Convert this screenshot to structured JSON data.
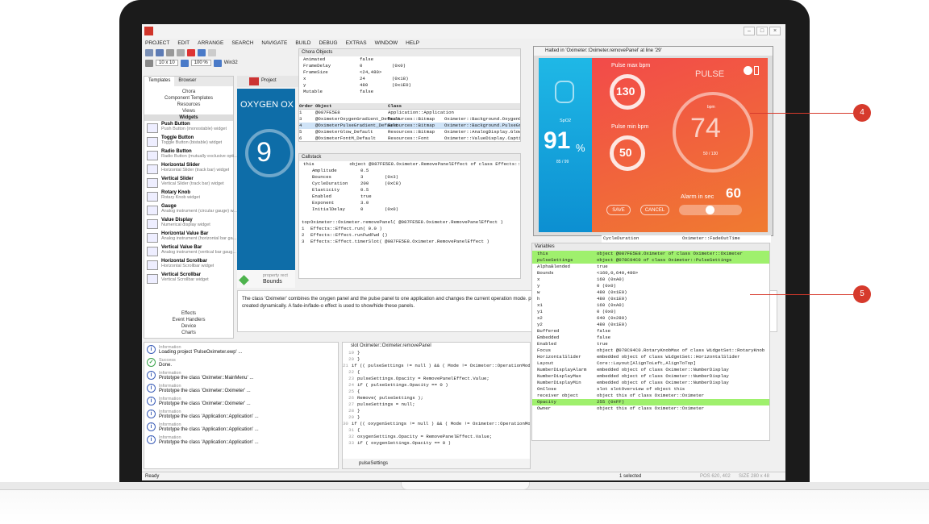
{
  "menu": [
    "PROJECT",
    "EDIT",
    "ARRANGE",
    "SEARCH",
    "NAVIGATE",
    "BUILD",
    "DEBUG",
    "EXTRAS",
    "WINDOW",
    "HELP"
  ],
  "toolbar": {
    "zoom1": "10 x 10",
    "zoom2": "100 %",
    "platform": "Win32"
  },
  "left": {
    "tabs": [
      "Templates",
      "Browser"
    ],
    "tree": [
      "Chora",
      "Component Templates",
      "Resources",
      "Views"
    ],
    "section": "Widgets",
    "widgets": [
      {
        "name": "Push Button",
        "desc": "Push Button (monostable) widget"
      },
      {
        "name": "Toggle Button",
        "desc": "Toggle Button (bistable) widget"
      },
      {
        "name": "Radio Button",
        "desc": "Radio Button (mutually exclusive opti..."
      },
      {
        "name": "Horizontal Slider",
        "desc": "Horizontal Slider (track bar) widget"
      },
      {
        "name": "Vertical Slider",
        "desc": "Vertical Slider (track bar) widget"
      },
      {
        "name": "Rotary Knob",
        "desc": "Rotary Knob widget"
      },
      {
        "name": "Gauge",
        "desc": "Analog instrument (circular gauge) w..."
      },
      {
        "name": "Value Display",
        "desc": "Numerical display widget"
      },
      {
        "name": "Horizontal Value Bar",
        "desc": "Analog instrument (horizontal bar ga..."
      },
      {
        "name": "Vertical Value Bar",
        "desc": "Analog instrument (vertical bar gaug..."
      },
      {
        "name": "Horizontal Scrollbar",
        "desc": "Horizontal Scrollbar widget"
      },
      {
        "name": "Vertical Scrollbar",
        "desc": "Vertical Scrollbar widget"
      }
    ],
    "bottom": [
      "Effects",
      "Event Handlers",
      "Device",
      "Charts"
    ]
  },
  "canvas": {
    "title": "OXYGEN OX",
    "project_tab": "Project",
    "prop_label": "property rect",
    "prop_name": "Bounds",
    "big": "9"
  },
  "description": "The class 'Oximeter' combines the oxygen panel and the pulse panel to one application and changes the current operation mode. pulse oximeter. All temporarily used panels, like the main menu, the graph panel or the settings panels are created dynamically. A fade-in/fade-o effect is used to show/hide these panels.",
  "chora": {
    "title": "Chora Objects",
    "props": [
      [
        "Animated",
        "false",
        ""
      ],
      [
        "FrameDelay",
        "0",
        "(0x0)"
      ],
      [
        "FrameSize",
        "<24,480>",
        ""
      ],
      [
        "x",
        "24",
        "(0x18)"
      ],
      [
        "y",
        "480",
        "(0x1E0)"
      ],
      [
        "Mutable",
        "false",
        ""
      ]
    ],
    "cols": [
      "Order",
      "Object",
      "Class"
    ],
    "rows": [
      [
        "1",
        "@087FE5E8",
        "Application::Application"
      ],
      [
        "3",
        "@OximeterOxygenGradient_Default",
        "Resources::Bitmap",
        "Oximeter::Background.OxygenGradi"
      ],
      [
        "4",
        "@OximeterPulseGradient_Default",
        "Resources::Bitmap",
        "Oximeter::Background.PulseGradien"
      ],
      [
        "5",
        "@OximeterGlow_Default",
        "Resources::Bitmap",
        "Oximeter::AnalogDisplay.Glow.Bitm"
      ],
      [
        "6",
        "@OximeterFontM_Default",
        "Resources::Font",
        "Oximeter::ValueDisplay.CaptionText..."
      ]
    ]
  },
  "callstack": {
    "title": "Callstack",
    "this_row": "this",
    "this_val": "object @087FE5E8.Oximeter.RemovePanelEffect of class Effects::",
    "props": [
      [
        "Amplitude",
        "0.5",
        ""
      ],
      [
        "Bounces",
        "3",
        "(0x3)"
      ],
      [
        "CycleDuration",
        "200",
        "(0xC8)"
      ],
      [
        "Elasticity",
        "0.5",
        ""
      ],
      [
        "Enabled",
        "true",
        ""
      ],
      [
        "Exponent",
        "3.0",
        ""
      ],
      [
        "InitialDelay",
        "0",
        "(0x0)"
      ]
    ],
    "frames": [
      [
        "top",
        "Oximeter::Oximeter.removePanel( @087FE5E8.Oximeter.RemovePanelEffect )"
      ],
      [
        "1",
        "Effects::Effect.run( 0.0 )"
      ],
      [
        "2",
        "Effects::Effect.runFwdFwd ()"
      ],
      [
        "3",
        "Effects::Effect.timerSlot( @087FE5E8.Oximeter.RemovePanelEffect )"
      ]
    ]
  },
  "oximeter": {
    "halted": "Halted in 'Oximeter::Oximeter.removePanel' at line '29'",
    "spo2_label": "SpO2",
    "spo2": "91",
    "percent": "%",
    "spo2_range": "85 / 99",
    "max_label": "Pulse max bpm",
    "max": "130",
    "min_label": "Pulse min bpm",
    "min": "50",
    "pulse_label": "PULSE",
    "bpm_label": "bpm",
    "pulse": "74",
    "pulse_range": "50 / 130",
    "alarm_label": "Alarm in sec",
    "alarm": "60",
    "save": "SAVE",
    "cancel": "CANCEL",
    "slider_level": 0.5
  },
  "log": {
    "entries": [
      [
        "Information",
        "Loading project 'PulseOximeter.ewp' ...",
        "i"
      ],
      [
        "Success",
        "Done.",
        "ok"
      ],
      [
        "Information",
        "Prototype the class 'Oximeter::MainMenu' ...",
        "i"
      ],
      [
        "Information",
        "Prototype the class 'Oximeter::Oximeter' ...",
        "i"
      ],
      [
        "Information",
        "Prototype the class 'Oximeter::Oximeter' ...",
        "i"
      ],
      [
        "Information",
        "Prototype the class 'Application::Application' ...",
        "i"
      ],
      [
        "Information",
        "Prototype the class 'Application::Application' ...",
        "i"
      ],
      [
        "Information",
        "Prototype the class 'Application::Application' ...",
        "i"
      ]
    ]
  },
  "code": {
    "title": "slot Oximeter::Oximeter.removePanel",
    "lines": [
      [
        "19",
        "  }"
      ],
      [
        "20",
        "}"
      ],
      [
        "21",
        "if (( pulseSettings != null ) && ( Mode != Oximeter::OperationMode.Pu"
      ],
      [
        "22",
        "{"
      ],
      [
        "23",
        "  pulseSettings.Opacity = RemovePanelEffect.Value;"
      ],
      [
        "24",
        "  if ( pulseSettings.Opacity == 0 )"
      ],
      [
        "25",
        "  {"
      ],
      [
        "26",
        "    Remove( pulseSettings );"
      ],
      [
        "27",
        "    pulseSettings = null;"
      ],
      [
        "28",
        "  }"
      ],
      [
        "29",
        "}"
      ],
      [
        "30",
        "if (( oxygenSettings != null ) && ( Mode != Oximeter::OperationMode.Pu"
      ],
      [
        "31",
        "{"
      ],
      [
        "32",
        "  oxygenSettings.Opacity = RemovePanelEffect.Value;"
      ],
      [
        "33",
        "  if ( oxygenSettings.Opacity == 0 )"
      ]
    ],
    "search": "pulseSettings"
  },
  "variables": {
    "title": "Variables",
    "behind_key": "CycleDuration",
    "behind_val": "Oximeter::FadeOutTime",
    "rows": [
      [
        "this",
        "object @087FE5E8.Oximeter of class Oximeter::Oximeter",
        "g"
      ],
      [
        "pulseSettings",
        "object @078C94C0 of class Oximeter::PulseSettings",
        "g"
      ],
      [
        "AlphaBlended",
        "true",
        ""
      ],
      [
        "Bounds",
        "<160,0,640,480>",
        ""
      ],
      [
        "x",
        "160   (0xA0)",
        ""
      ],
      [
        "y",
        "0   (0x0)",
        ""
      ],
      [
        "w",
        "480   (0x1E0)",
        ""
      ],
      [
        "h",
        "480   (0x1E0)",
        ""
      ],
      [
        "x1",
        "160   (0xA0)",
        ""
      ],
      [
        "y1",
        "0   (0x0)",
        ""
      ],
      [
        "x2",
        "640   (0x280)",
        ""
      ],
      [
        "y2",
        "480   (0x1E0)",
        ""
      ],
      [
        "Buffered",
        "false",
        ""
      ],
      [
        "Embedded",
        "false",
        ""
      ],
      [
        "Enabled",
        "true",
        ""
      ],
      [
        "Focus",
        "object @078C94C0.RotaryKnobMax of class WidgetSet::RotaryKnob",
        ""
      ],
      [
        "HorizontalSlider",
        "embedded object of class WidgetSet::HorizontalSlider",
        ""
      ],
      [
        "Layout",
        "Core::Layout[AlignToLeft,AlignToTop]",
        ""
      ],
      [
        "NumberDisplayAlarm",
        "embedded object of class Oximeter::NumberDisplay",
        ""
      ],
      [
        "NumberDisplayMax",
        "embedded object of class Oximeter::NumberDisplay",
        ""
      ],
      [
        "NumberDisplayMin",
        "embedded object of class Oximeter::NumberDisplay",
        ""
      ],
      [
        "OnClose",
        "slot slotOverview of object this",
        ""
      ],
      [
        "receiver object",
        "object this of class Oximeter::Oximeter",
        ""
      ],
      [
        "Opacity",
        "255   (0xFF)",
        "g"
      ],
      [
        "Owner",
        "object this of class Oximeter::Oximeter",
        ""
      ]
    ]
  },
  "status": {
    "left": "Ready",
    "selected": "1 selected",
    "pos": "POS  620, 402",
    "size": "SIZE  280 x 48"
  },
  "callouts": [
    "4",
    "5"
  ]
}
